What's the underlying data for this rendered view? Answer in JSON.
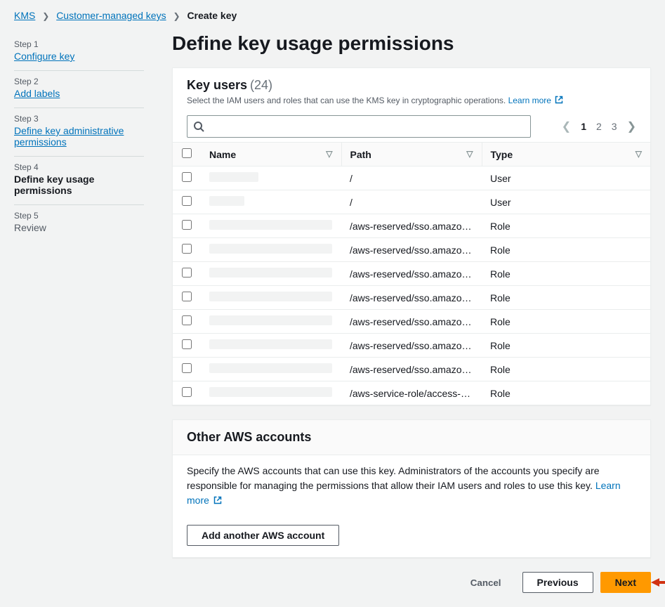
{
  "breadcrumb": {
    "root": "KMS",
    "level2": "Customer-managed keys",
    "current": "Create key"
  },
  "wizard": {
    "steps": [
      {
        "num": "Step 1",
        "title": "Configure key",
        "link": true
      },
      {
        "num": "Step 2",
        "title": "Add labels",
        "link": true
      },
      {
        "num": "Step 3",
        "title": "Define key administrative permissions",
        "link": true
      },
      {
        "num": "Step 4",
        "title": "Define key usage permissions",
        "active": true
      },
      {
        "num": "Step 5",
        "title": "Review",
        "inactive": true
      }
    ]
  },
  "page": {
    "heading": "Define key usage permissions"
  },
  "keyUsers": {
    "title": "Key users",
    "count": "(24)",
    "desc_prefix": "Select the IAM users and roles that can use the KMS key in cryptographic operations. ",
    "learn_more": "Learn more",
    "pagination": {
      "pages": [
        "1",
        "2",
        "3"
      ],
      "active": "1"
    },
    "columns": {
      "name": "Name",
      "path": "Path",
      "type": "Type"
    },
    "rows": [
      {
        "nameWidth": 70,
        "path": "/",
        "type": "User"
      },
      {
        "nameWidth": 50,
        "path": "/",
        "type": "User"
      },
      {
        "nameWidth": 175,
        "path": "/aws-reserved/sso.amazonaws…",
        "type": "Role"
      },
      {
        "nameWidth": 175,
        "path": "/aws-reserved/sso.amazonaws…",
        "type": "Role"
      },
      {
        "nameWidth": 175,
        "path": "/aws-reserved/sso.amazonaws…",
        "type": "Role"
      },
      {
        "nameWidth": 175,
        "path": "/aws-reserved/sso.amazonaws…",
        "type": "Role"
      },
      {
        "nameWidth": 175,
        "path": "/aws-reserved/sso.amazonaws…",
        "type": "Role"
      },
      {
        "nameWidth": 175,
        "path": "/aws-reserved/sso.amazonaws…",
        "type": "Role"
      },
      {
        "nameWidth": 175,
        "path": "/aws-reserved/sso.amazonaws…",
        "type": "Role"
      },
      {
        "nameWidth": 175,
        "path": "/aws-service-role/access-analy…",
        "type": "Role"
      }
    ]
  },
  "otherAccounts": {
    "title": "Other AWS accounts",
    "desc_prefix": "Specify the AWS accounts that can use this key. Administrators of the accounts you specify are responsible for managing the permissions that allow their IAM users and roles to use this key. ",
    "learn_more": "Learn more",
    "add_button": "Add another AWS account"
  },
  "footer": {
    "cancel": "Cancel",
    "previous": "Previous",
    "next": "Next"
  }
}
